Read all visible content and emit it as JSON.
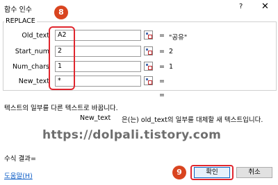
{
  "dialog": {
    "title": "함수 인수",
    "help_symbol": "?",
    "close_symbol": "✕"
  },
  "function_group": {
    "name": "REPLACE",
    "args": [
      {
        "label": "Old_text",
        "value": "A2",
        "equals": "=",
        "result": "\"공유\""
      },
      {
        "label": "Start_num",
        "value": "2",
        "equals": "=",
        "result": "2"
      },
      {
        "label": "Num_chars",
        "value": "1",
        "equals": "=",
        "result": "1"
      },
      {
        "label": "New_text",
        "value": "*",
        "equals": "=",
        "result": ""
      }
    ],
    "result_equals": "="
  },
  "description": {
    "main": "텍스트의 일부를 다른 텍스트로 바꿉니다.",
    "arg_name": "New_text",
    "arg_text": "은(는) old_text의 일부를 대체할 새 텍스트입니다."
  },
  "watermark": "https://dolpali.tistory.com",
  "footer": {
    "formula_result": "수식 결과=",
    "help_link": "도움말(H)",
    "ok_label": "확인",
    "cancel_label": "취소"
  },
  "annotations": {
    "badge_8": "8",
    "badge_9": "9",
    "accent_color": "#e0262e",
    "badge_color": "#d9441f"
  }
}
